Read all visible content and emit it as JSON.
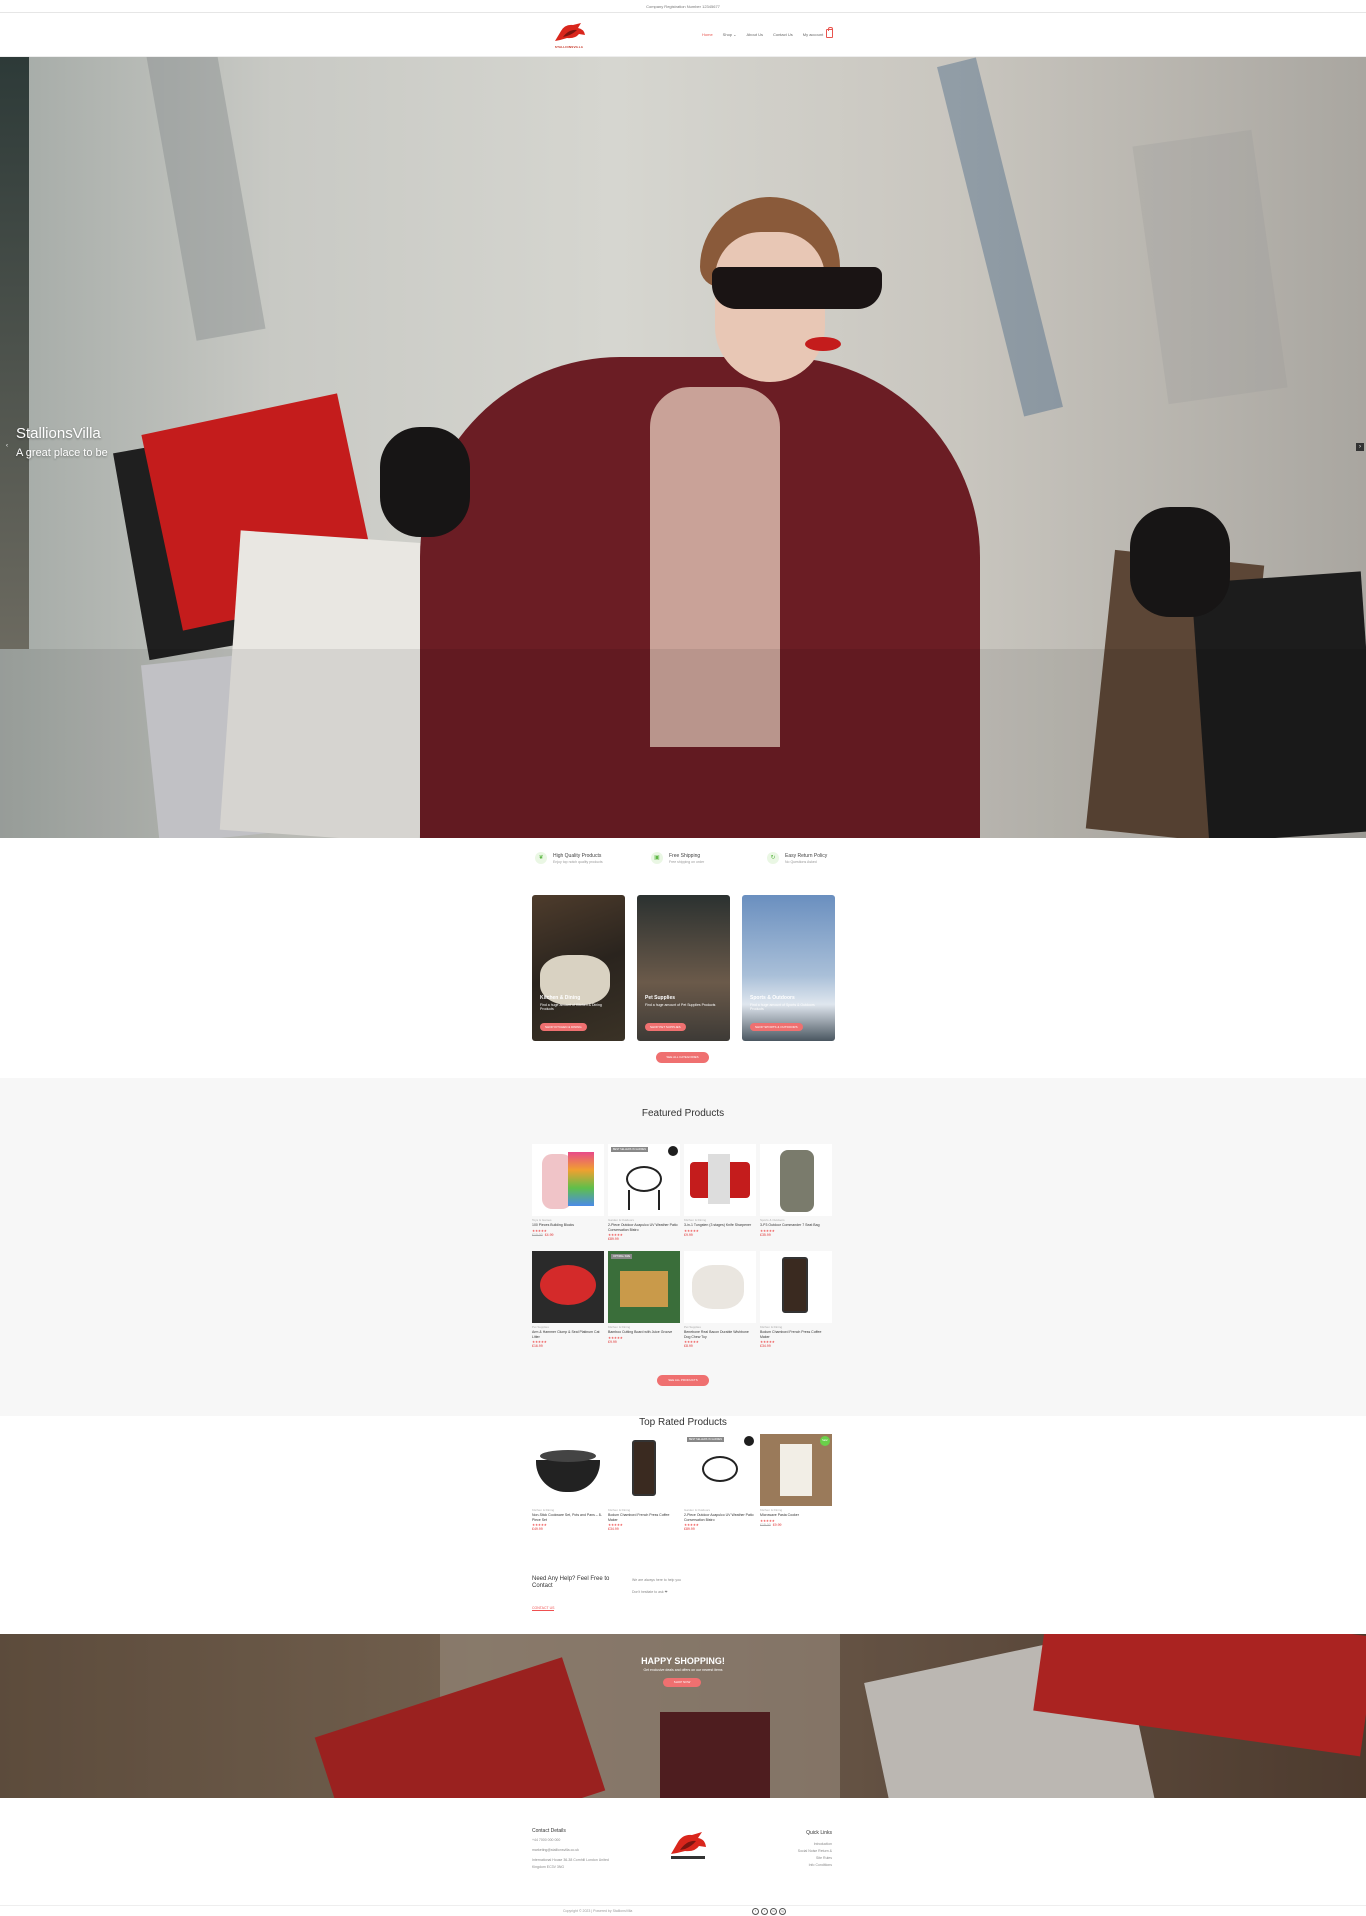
{
  "topbar": {
    "text": "Company Registration Number 12345677"
  },
  "brand": {
    "name": "STALLIONSVILLA",
    "accent": "#e8544e"
  },
  "nav": {
    "items": [
      "Home",
      "Shop",
      "About Us",
      "Contact Us",
      "My account"
    ]
  },
  "hero": {
    "title": "StallionsVilla",
    "subtitle": "A great place to be",
    "prev": "‹",
    "next": "›"
  },
  "features": [
    {
      "icon": "leaf-icon",
      "glyph": "❦",
      "title": "High Quality Products",
      "sub": "Enjoy top notch quality products"
    },
    {
      "icon": "shipping-icon",
      "glyph": "▣",
      "title": "Free Shipping",
      "sub": "Free shipping on order"
    },
    {
      "icon": "return-icon",
      "glyph": "↻",
      "title": "Easy Return Policy",
      "sub": "No Questions Asked"
    }
  ],
  "categories": [
    {
      "title": "Kitchen & Dining",
      "desc": "Find a huge amount of Kitchen & Dining Products",
      "button": "SHOP KITCHEN & DINING"
    },
    {
      "title": "Pet Supplies",
      "desc": "Find a huge amount of Pet Supplies Products",
      "button": "SHOP PET SUPPLIES"
    },
    {
      "title": "Sports & Outdoors",
      "desc": "Find a huge amount of Sports & Outdoors Products",
      "button": "SHOP SPORTS & OUTDOORS"
    }
  ],
  "view_all_categories": "SEE ALL CATEGORIES",
  "featured": {
    "title": "Featured Products",
    "view_all": "SEE ALL PRODUCTS",
    "products": [
      {
        "cat": "Toys & Games",
        "name": "100 Pieces Building Blocks",
        "stars": "★★★★★",
        "old": "£10.00",
        "price": "£4.99",
        "badge": "",
        "dot": ""
      },
      {
        "cat": "Garden & Outdoors",
        "name": "2-Piece Outdoor Acapulco UV Weather Patio Conversation Bistro",
        "stars": "★★★★★",
        "old": "",
        "price": "£89.99",
        "badge": "BEST SELLERS IN GARDEN",
        "dot": "black"
      },
      {
        "cat": "Kitchen & Dining",
        "name": "3-in-1 Tungsten (3 stages) Knife Sharpener",
        "stars": "★★★★★",
        "old": "",
        "price": "£9.99",
        "badge": "",
        "dot": ""
      },
      {
        "cat": "Sports & Outdoors",
        "name": "3-P3 Outdoor Commander 7 Seat Bag",
        "stars": "★★★★★",
        "old": "",
        "price": "£35.99",
        "badge": "",
        "dot": ""
      },
      {
        "cat": "Pet Supplies",
        "name": "Arm & Hammer Clump & Seal Platinum Cat Litter",
        "stars": "★★★★★",
        "old": "",
        "price": "£16.99",
        "badge": "",
        "dot": ""
      },
      {
        "cat": "Kitchen & Dining",
        "name": "Bamboo Cutting Board with Juice Groove",
        "stars": "★★★★★",
        "old": "",
        "price": "£9.99",
        "badge": "OPTIMAL SIZE",
        "dot": ""
      },
      {
        "cat": "Pet Supplies",
        "name": "Benebone Real Bacon Durable Wishbone Dog Chew Toy",
        "stars": "★★★★★",
        "old": "",
        "price": "£8.99",
        "badge": "",
        "dot": ""
      },
      {
        "cat": "Kitchen & Dining",
        "name": "Bodum Chambord French Press Coffee Maker",
        "stars": "★★★★★",
        "old": "",
        "price": "£34.99",
        "badge": "",
        "dot": ""
      }
    ]
  },
  "top_rated": {
    "title": "Top Rated Products",
    "products": [
      {
        "cat": "Kitchen & Dining",
        "name": "Non-Stick Cookware Set, Pots and Pans – 8-Piece Set",
        "stars": "★★★★★",
        "old": "",
        "price": "£49.99",
        "badge": "",
        "dot": ""
      },
      {
        "cat": "Kitchen & Dining",
        "name": "Bodum Chambord French Press Coffee Maker",
        "stars": "★★★★★",
        "old": "",
        "price": "£34.99",
        "badge": "",
        "dot": ""
      },
      {
        "cat": "Garden & Outdoors",
        "name": "2-Piece Outdoor Acapulco UV Weather Patio Conversation Bistro",
        "stars": "★★★★★",
        "old": "",
        "price": "£89.99",
        "badge": "BEST SELLERS IN GARDEN",
        "dot": "black"
      },
      {
        "cat": "Kitchen & Dining",
        "name": "Microwave Pasta Cooker",
        "stars": "★★★★★",
        "old": "£15.00",
        "price": "£9.99",
        "badge": "",
        "dot": "sale"
      }
    ]
  },
  "sale_label": "Sale!",
  "help": {
    "heading": "Need Any Help? Feel Free to Contact",
    "link": "CONTACT US",
    "p1": "We are always here to help you",
    "p2": "Don't hesitate to ask ❤"
  },
  "banner": {
    "title": "HAPPY SHOPPING!",
    "sub": "Get exclusive deals and offers on our newest items",
    "button": "SHOP NOW"
  },
  "footer": {
    "contact_title": "Contact Details",
    "phone": "+44 7000 000 000",
    "email": "marketing@stallionsvilla.co.uk",
    "address": "International House 36-38 Cornhill London United",
    "address2": "Kingdom EC3V 3NG",
    "quick_title": "Quick Links",
    "quick_links": [
      "Introduction",
      "Social Noise Return &",
      "Site Rules",
      "Info Conditions"
    ]
  },
  "copyright": "Copyright © 2023 | Powered by StallionsVilla",
  "socials": [
    "f",
    "t",
    "in",
    "ig"
  ]
}
